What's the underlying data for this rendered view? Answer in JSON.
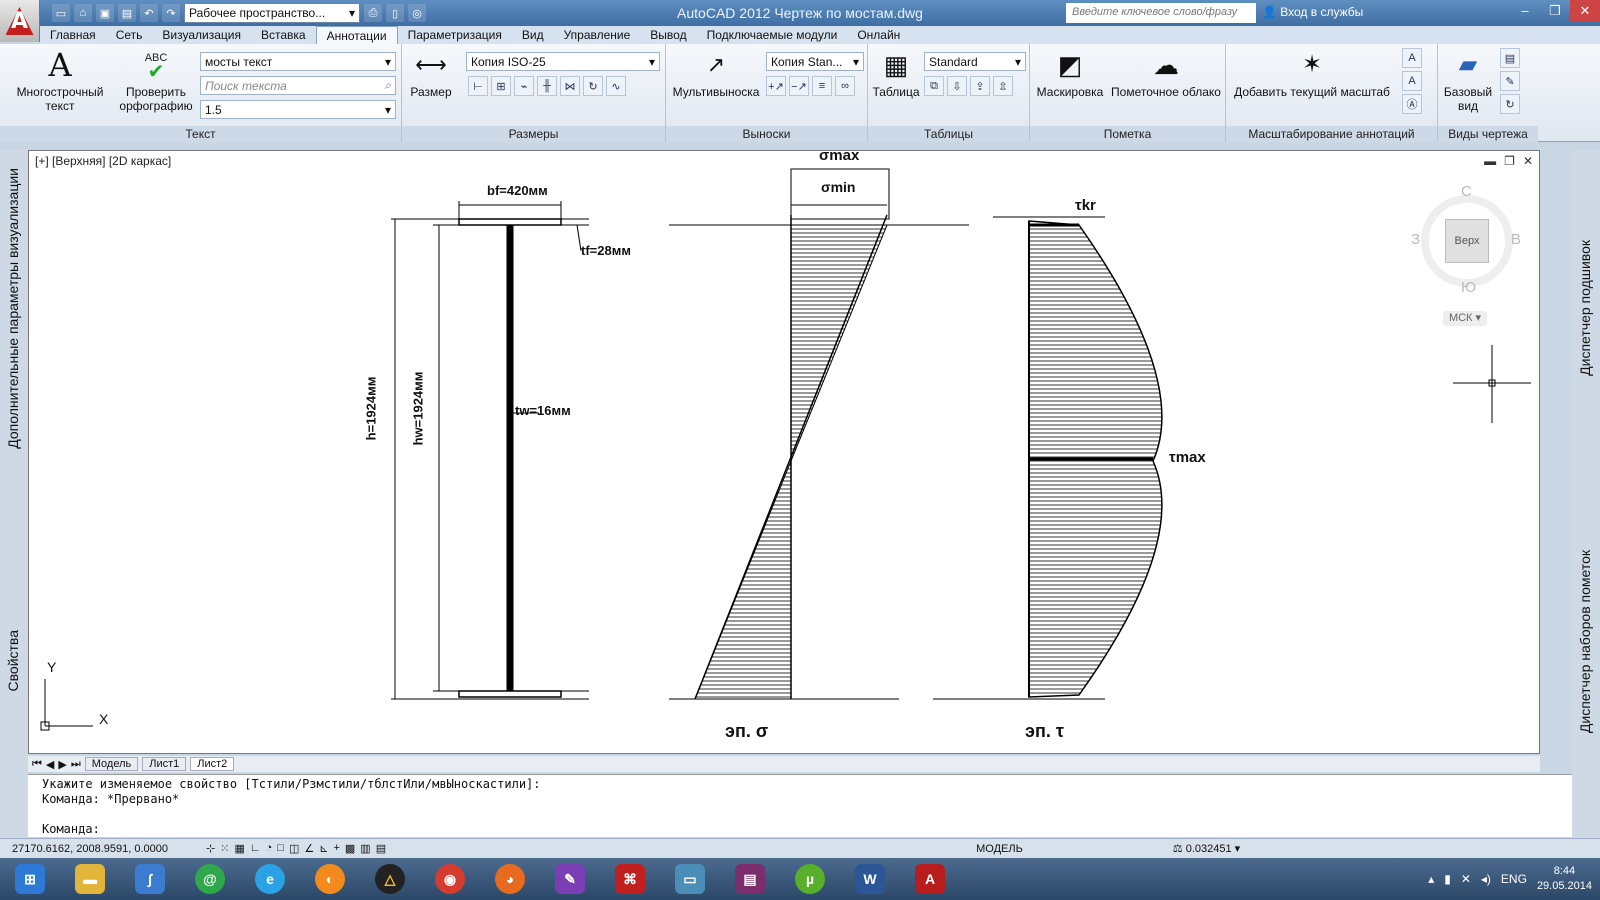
{
  "window": {
    "title": "AutoCAD 2012   Чертеж по мостам.dwg",
    "workspace": "Рабочее пространство...",
    "search_placeholder": "Введите ключевое слово/фразу",
    "login": "Вход в службы"
  },
  "ribbon_tabs": [
    "Главная",
    "Сеть",
    "Визуализация",
    "Вставка",
    "Аннотации",
    "Параметризация",
    "Вид",
    "Управление",
    "Вывод",
    "Подключаемые модули",
    "Онлайн"
  ],
  "active_tab": "Аннотации",
  "ribbon": {
    "text_panel": {
      "title": "Текст",
      "mtext_label": "Многострочный текст",
      "spell_label": "Проверить орфографию",
      "style_value": "мосты текст",
      "find_placeholder": "Поиск текста",
      "height_value": "1.5"
    },
    "dims_panel": {
      "title": "Размеры",
      "dim_label": "Размер",
      "style_value": "Копия ISO-25"
    },
    "leaders_panel": {
      "title": "Выноски",
      "mleader_label": "Мультивыноска",
      "style_value": "Копия Stan..."
    },
    "tables_panel": {
      "title": "Таблицы",
      "table_label": "Таблица",
      "style_value": "Standard"
    },
    "markup_panel": {
      "title": "Пометка",
      "wipeout_label": "Маскировка",
      "cloud_label": "Пометочное облако"
    },
    "scale_panel": {
      "title": "Масштабирование аннотаций",
      "add_scale_label": "Добавить текущий масштаб"
    },
    "views_panel": {
      "title": "Виды чертежа",
      "base_view_label": "Базовый вид"
    }
  },
  "viewport": {
    "label": "[+] [Верхняя] [2D каркас]",
    "viewcube": {
      "top": "Верх",
      "n": "С",
      "s": "Ю",
      "w": "З",
      "e": "В",
      "ucs": "МСК"
    }
  },
  "drawing": {
    "bf": "bf=420мм",
    "tf": "tf=28мм",
    "tw": "tw=16мм",
    "h": "h=1924мм",
    "hw": "hw=1924мм",
    "sigma_max": "σmax",
    "sigma_min": "σmin",
    "tau_kr": "τkr",
    "tau_max": "τmax",
    "ep_sigma": "эп. σ",
    "ep_tau": "эп. τ",
    "axis_y": "Y",
    "axis_x": "X"
  },
  "side_palettes": {
    "left_top": "Дополнительные параметры визуализации",
    "left_bottom": "Свойства",
    "right_top": "Диспетчер подшивок",
    "right_bottom": "Диспетчер наборов пометок"
  },
  "layout_tabs": [
    "Модель",
    "Лист1",
    "Лист2"
  ],
  "active_layout": "Лист2",
  "command_history": [
    "Укажите изменяемое свойство [Тстили/Рзмстили/тблстИли/мвЫноскастили]:",
    "Команда: *Прервано*",
    "",
    "Команда:"
  ],
  "status": {
    "coords": "27170.6162, 2008.9591, 0.0000",
    "model": "МОДЕЛЬ",
    "scale": "0.032451"
  },
  "tray": {
    "lang": "ENG",
    "time": "8:44",
    "date": "29.05.2014"
  }
}
